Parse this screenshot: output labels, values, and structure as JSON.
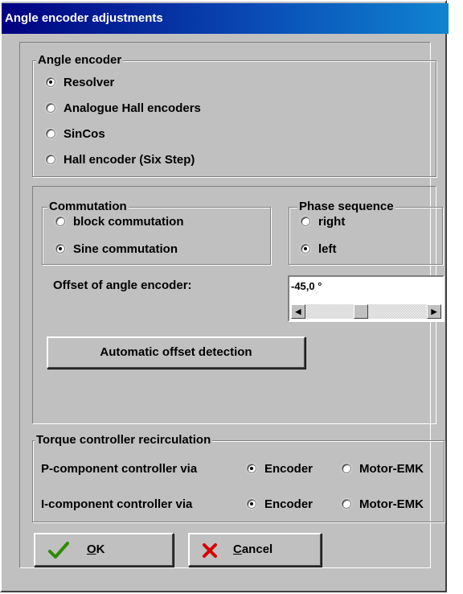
{
  "window": {
    "title": "Angle encoder adjustments"
  },
  "angle_encoder": {
    "legend": "Angle encoder",
    "options": [
      {
        "label": "Resolver",
        "selected": true
      },
      {
        "label": "Analogue Hall encoders",
        "selected": false
      },
      {
        "label": "SinCos",
        "selected": false
      },
      {
        "label": "Hall encoder (Six Step)",
        "selected": false
      }
    ]
  },
  "commutation": {
    "legend": "Commutation",
    "options": [
      {
        "label": "block commutation",
        "selected": false
      },
      {
        "label": "Sine commutation",
        "selected": true
      }
    ]
  },
  "phase_sequence": {
    "legend": "Phase sequence",
    "options": [
      {
        "label": "right",
        "selected": false
      },
      {
        "label": "left",
        "selected": true
      }
    ]
  },
  "offset": {
    "label": "Offset of angle encoder:",
    "value": "-45,0 °",
    "slider_fraction": 0.45
  },
  "auto_offset_button": "Automatic offset detection",
  "torque": {
    "legend": "Torque controller recirculation",
    "rows": [
      {
        "label": "P-component controller via",
        "options": [
          {
            "label": "Encoder",
            "selected": true
          },
          {
            "label": "Motor-EMK",
            "selected": false
          }
        ]
      },
      {
        "label": "I-component controller via",
        "options": [
          {
            "label": "Encoder",
            "selected": true
          },
          {
            "label": "Motor-EMK",
            "selected": false
          }
        ]
      }
    ]
  },
  "buttons": {
    "ok": "OK",
    "cancel": "Cancel"
  },
  "colors": {
    "title_start": "#000080",
    "title_end": "#1084d0",
    "ok_check": "#2e8b00",
    "cancel_x": "#d40000",
    "face": "#c0c0c0"
  },
  "icons": {
    "ok": "check-icon",
    "cancel": "x-icon"
  }
}
